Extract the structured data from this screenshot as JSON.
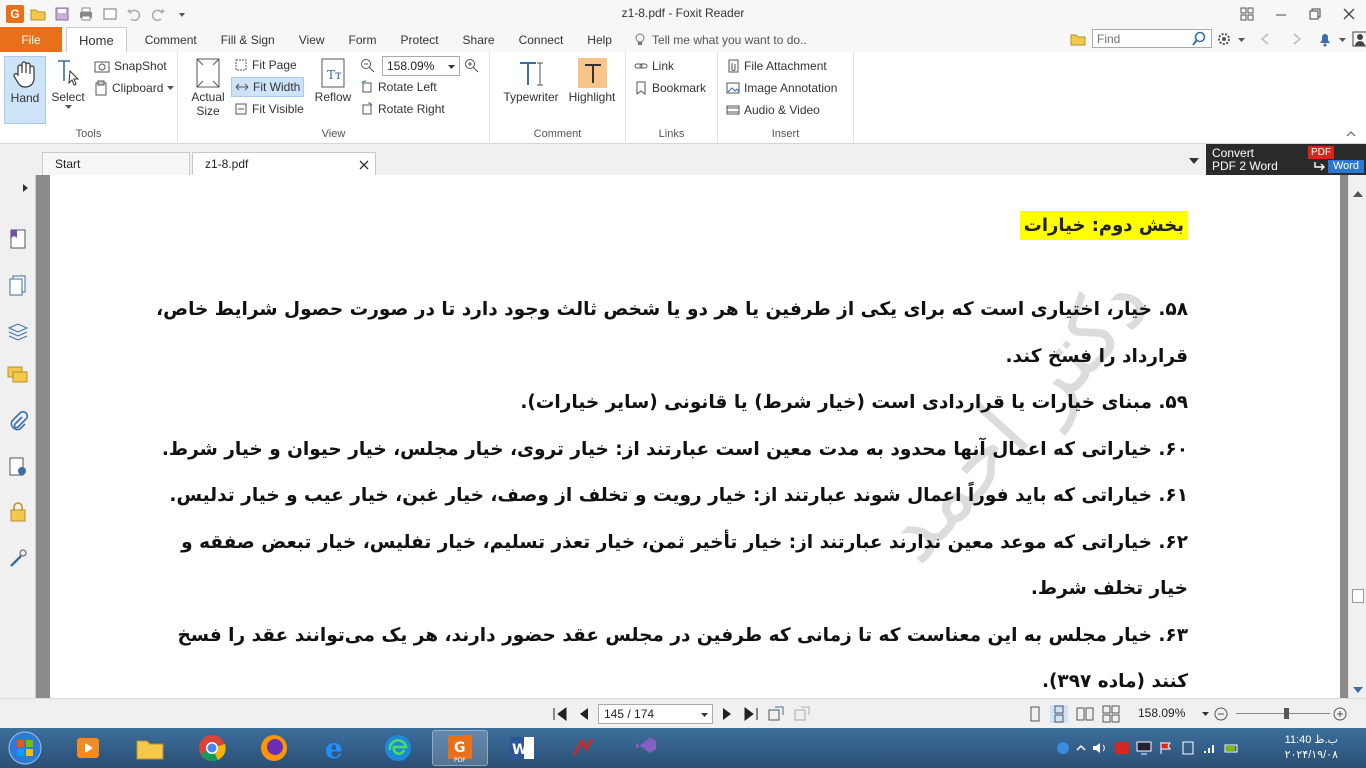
{
  "window": {
    "title": "z1-8.pdf - Foxit Reader"
  },
  "ribbon_tabs": {
    "file": "File",
    "tabs": [
      "Home",
      "Comment",
      "Fill & Sign",
      "View",
      "Form",
      "Protect",
      "Share",
      "Connect",
      "Help"
    ],
    "tell_me": "Tell me what you want to do..",
    "find_placeholder": "Find"
  },
  "ribbon": {
    "tools": {
      "hand": "Hand",
      "select": "Select",
      "snapshot": "SnapShot",
      "clipboard": "Clipboard",
      "label": "Tools"
    },
    "view": {
      "actual_size_1": "Actual",
      "actual_size_2": "Size",
      "fit_page": "Fit Page",
      "fit_width": "Fit Width",
      "fit_visible": "Fit Visible",
      "reflow": "Reflow",
      "zoom": "158.09%",
      "rotate_left": "Rotate Left",
      "rotate_right": "Rotate Right",
      "label": "View"
    },
    "comment": {
      "typewriter": "Typewriter",
      "highlight": "Highlight",
      "label": "Comment"
    },
    "links": {
      "link": "Link",
      "bookmark": "Bookmark",
      "label": "Links"
    },
    "insert": {
      "file_attachment": "File Attachment",
      "image_annotation": "Image Annotation",
      "audio_video": "Audio & Video",
      "label": "Insert"
    }
  },
  "doc_tabs": [
    "Start",
    "z1-8.pdf"
  ],
  "convert_banner": {
    "line1": "Convert",
    "line2": "PDF 2 Word",
    "badge_pdf": "PDF",
    "badge_word": "Word"
  },
  "document": {
    "heading": "بخش دوم: خیارات",
    "lines": [
      "۵۸. خیار، اختیاری است که برای یکی از طرفین یا هر دو یا شخص ثالث وجود دارد تا در صورت حصول شرایط خاص،",
      "قرارداد را فسخ کند.",
      "۵۹. مبنای خیارات یا قراردادی است (خیار شرط) یا قانونی (سایر خیارات).",
      "۶۰. خیاراتی که اعمال آنها محدود به مدت معین است عبارتند از: خیار تروی، خیار مجلس، خیار حیوان و خیار شرط.",
      "۶۱. خیاراتی که باید فوراً اعمال شوند عبارتند از: خیار رویت و تخلف از وصف، خیار غبن، خیار عیب و خیار تدلیس.",
      "۶۲. خیاراتی که موعد معین ندارند عبارتند از: خیار تأخیر ثمن، خیار تعذر تسلیم، خیار تفلیس، خیار تبعض صفقه و",
      "خیار تخلف شرط.",
      "۶۳. خیار مجلس به این معناست که تا زمانی که طرفین در مجلس عقد حضور دارند، هر یک می‌توانند عقد را فسخ",
      "کنند (ماده ۳۹۷)."
    ],
    "justified": [
      true,
      false,
      false,
      false,
      false,
      true,
      false,
      true,
      false
    ],
    "watermark": "دکتر احمد"
  },
  "status": {
    "page": "145 / 174",
    "zoom": "158.09%"
  },
  "taskbar": {
    "time": "11:40 ب.ظ",
    "date": "۲۰۲۴/۱۹/۰۸"
  }
}
